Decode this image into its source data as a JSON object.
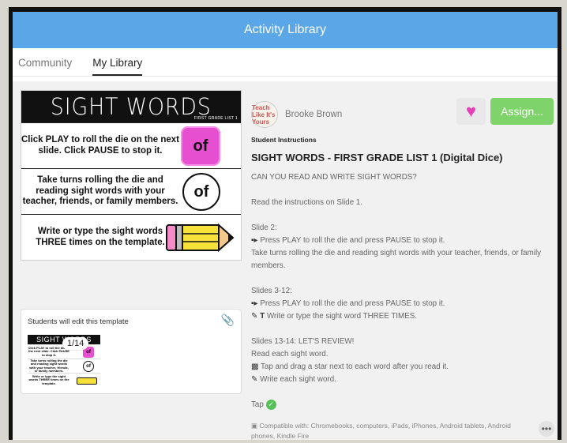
{
  "header": {
    "title": "Activity Library"
  },
  "tabs": [
    {
      "label": "Community",
      "active": false
    },
    {
      "label": "My Library",
      "active": true
    }
  ],
  "slide": {
    "title": "SIGHT WORDS",
    "subtitle": "FIRST GRADE LIST 1",
    "rows": [
      {
        "text": "Click PLAY to roll the die on the next slide. Click PAUSE to stop it.",
        "die": "of"
      },
      {
        "text": "Take turns rolling the die and reading sight words with your teacher, friends, or family members.",
        "die": "of"
      },
      {
        "text": "Write or type the sight words THREE times on the template.",
        "die": ""
      }
    ]
  },
  "template_card": {
    "title": "Students will edit this template",
    "pager": "1/14",
    "thumb_title": "SIGHT WORDS",
    "thumb_rows": [
      "Click PLAY to roll the die on the next slide. Click PAUSE to stop it.",
      "Take turns rolling the die and reading sight words with your teacher, friends, or family members.",
      "Write or type the sight words THREE times on the template."
    ],
    "thumb_die": "of"
  },
  "author": {
    "name": "Brooke Brown",
    "avatar_text": "Teach Like It's Yours"
  },
  "actions": {
    "assign_label": "Assign..."
  },
  "instructions": {
    "label": "Student Instructions",
    "title": "SIGHT WORDS - FIRST GRADE LIST 1 (Digital Dice)",
    "intro": "CAN YOU READ AND WRITE SIGHT WORDS?",
    "read": "Read the instructions on Slide 1.",
    "slide2_head": "Slide 2:",
    "slide2_play": "Press PLAY to roll the die and press PAUSE to stop it.",
    "slide2_turns": "Take turns rolling the die and reading sight words with your teacher, friends, or family members.",
    "slides3_head": "Slides 3-12:",
    "slides3_play": "Press PLAY to roll the die and press PAUSE to stop it.",
    "slides3_write": "Write or type the sight word THREE TIMES.",
    "slides13_head": "Slides 13-14: LET'S REVIEW!",
    "slides13_read": "Read each sight word.",
    "slides13_tap": "Tap and drag a star next to each word after you read it.",
    "slides13_write": "Write each sight word.",
    "tap_label": "Tap"
  },
  "compat": "Compatible with: Chromebooks, computers, iPads, iPhones, Android tablets, Android phones, Kindle Fire",
  "more_label": "•••"
}
